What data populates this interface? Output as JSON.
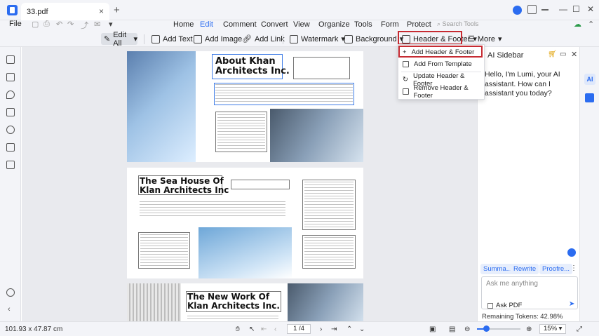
{
  "titlebar": {
    "tab_title": "33.pdf",
    "close": "×",
    "new_tab": "+",
    "min": "—",
    "max": "☐",
    "win_close": "✕"
  },
  "menu": {
    "file": "File",
    "items": [
      "Home",
      "Edit",
      "Comment",
      "Convert",
      "View",
      "Organize",
      "Tools",
      "Form",
      "Protect"
    ],
    "active": "Edit",
    "search_placeholder": "Search Tools"
  },
  "toolbar": {
    "edit_all": "Edit All",
    "add_text": "Add Text",
    "add_image": "Add Image",
    "add_link": "Add Link",
    "watermark": "Watermark",
    "background": "Background",
    "header_footer": "Header & Footer",
    "more": "More"
  },
  "dropdown": {
    "items": [
      "Add Header & Footer",
      "Add From Template",
      "Update Header & Footer",
      "Remove Header & Footer"
    ],
    "highlighted": "Add Header & Footer"
  },
  "document": {
    "page1_title_line1": "About Khan",
    "page1_title_line2": "Architects Inc.",
    "page2_title_line1": "The Sea House Of",
    "page2_title_line2": "Klan Architects Inc",
    "page3_title_line1": "The New Work Of",
    "page3_title_line2": "Klan Architects Inc."
  },
  "sidebar": {
    "title": "AI Sidebar",
    "greeting": "Hello, I'm Lumi, your AI assistant. How can I assistant you today?",
    "chips": [
      "Summa...",
      "Rewrite",
      "Proofre..."
    ],
    "ask_placeholder": "Ask me anything",
    "ask_pdf_label": "Ask PDF",
    "tokens": "Remaining Tokens: 42.98%"
  },
  "status": {
    "dimensions": "101.93 x 47.87 cm",
    "page_indicator": "1 /4",
    "zoom": "15%"
  },
  "colors": {
    "accent": "#2b6cf0",
    "highlight_border": "#c62b32"
  }
}
